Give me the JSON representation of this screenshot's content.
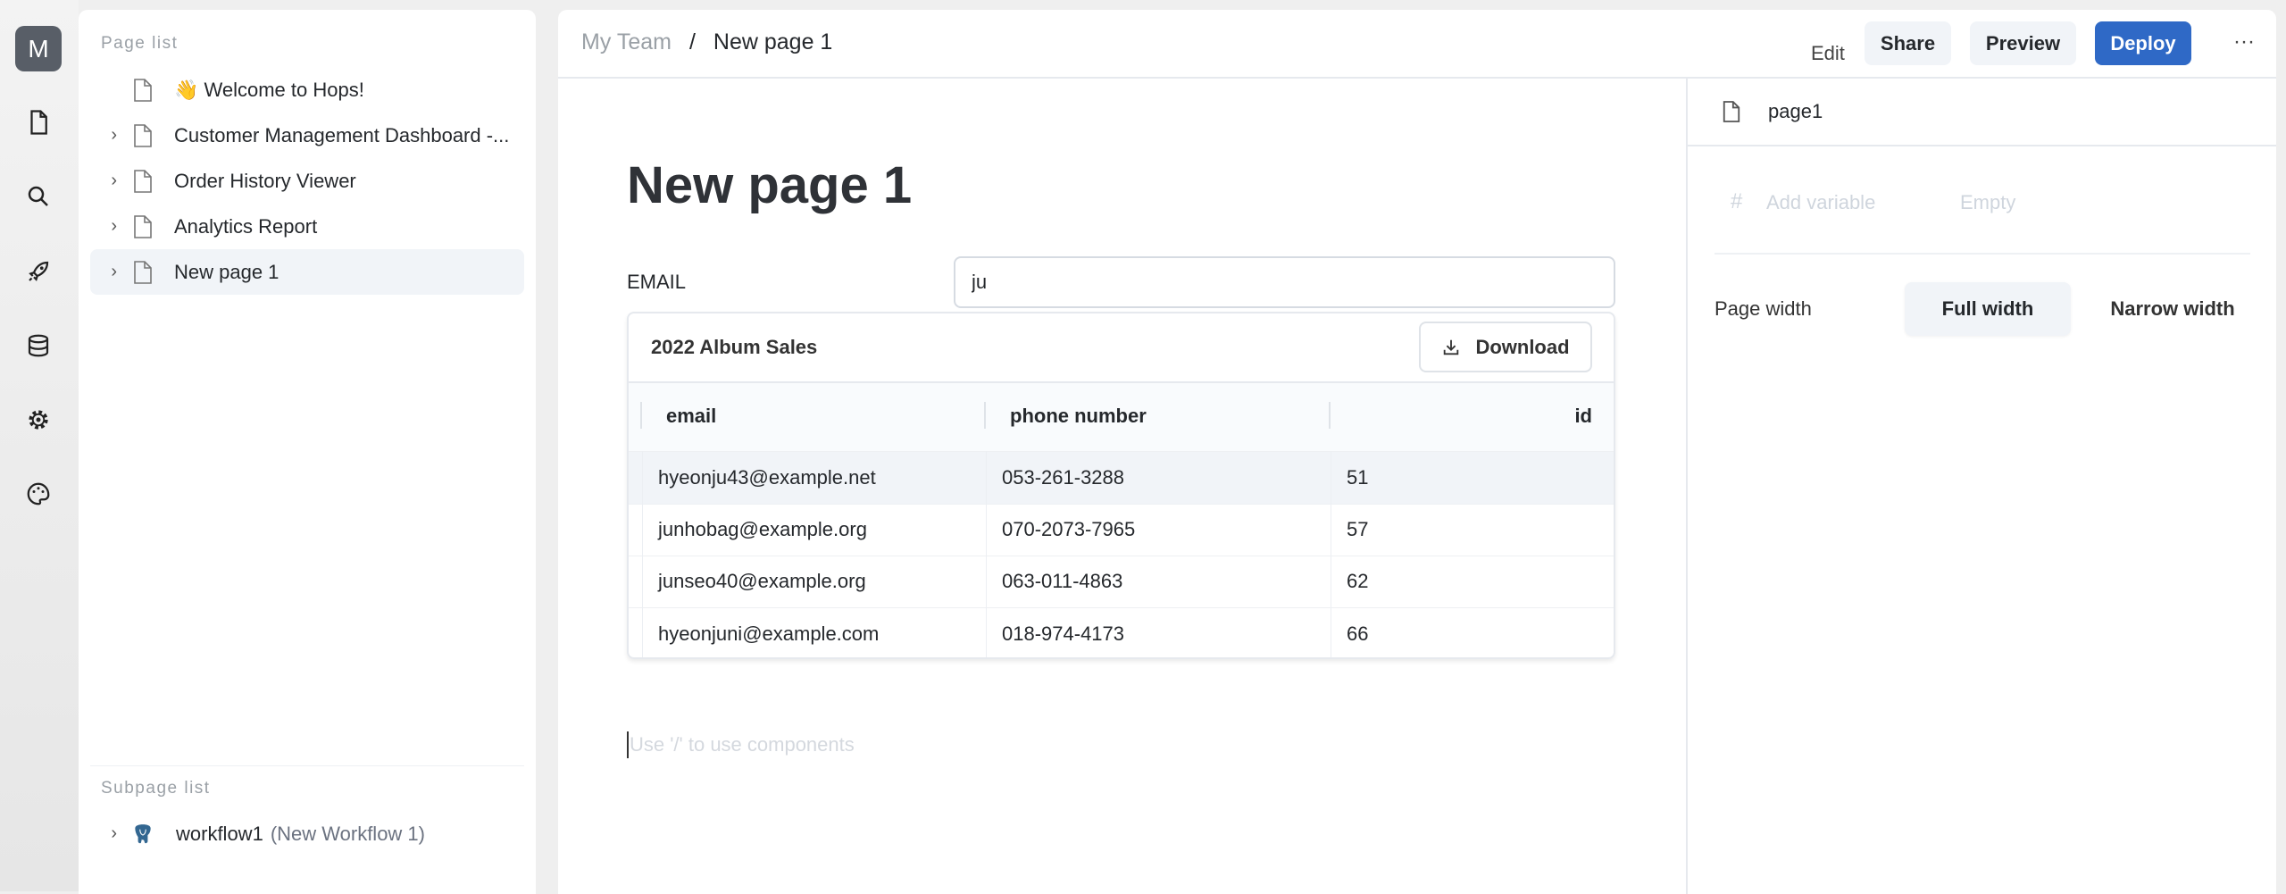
{
  "rail": {
    "avatar": "M",
    "icons": [
      "file-icon",
      "search-icon",
      "rocket-icon",
      "database-icon",
      "gear-icon",
      "palette-icon"
    ]
  },
  "sidebar": {
    "page_list_label": "Page list",
    "pages": [
      {
        "label": "👋 Welcome to Hops!",
        "expandable": false
      },
      {
        "label": "Customer Management Dashboard -...",
        "expandable": true
      },
      {
        "label": "Order History Viewer",
        "expandable": true
      },
      {
        "label": "Analytics Report",
        "expandable": true
      },
      {
        "label": "New page 1",
        "expandable": true,
        "selected": true
      }
    ],
    "subpage_list_label": "Subpage list",
    "subpages": [
      {
        "label": "workflow1",
        "sublabel": "(New Workflow 1)"
      }
    ]
  },
  "header": {
    "breadcrumb": [
      "My Team",
      "New page 1"
    ],
    "separator": "/",
    "edit": "Edit",
    "share": "Share",
    "preview": "Preview",
    "deploy": "Deploy",
    "more": "···"
  },
  "page": {
    "title": "New page 1",
    "email_label": "EMAIL",
    "email_value": "ju",
    "table": {
      "title": "2022 Album Sales",
      "download": "Download",
      "columns": [
        "email",
        "phone number",
        "id"
      ],
      "rows": [
        [
          "hyeonju43@example.net",
          "053-261-3288",
          "51"
        ],
        [
          "junhobag@example.org",
          "070-2073-7965",
          "57"
        ],
        [
          "junseo40@example.org",
          "063-011-4863",
          "62"
        ],
        [
          "hyeonjuni@example.com",
          "018-974-4173",
          "66"
        ]
      ]
    },
    "placeholder": "Use '/' to use components"
  },
  "right_panel": {
    "page_name": "page1",
    "add_variable": "Add variable",
    "empty": "Empty",
    "page_width_label": "Page width",
    "full_width": "Full width",
    "narrow_width": "Narrow width",
    "selected_width": "Full width"
  },
  "colors": {
    "accent": "#2f69c6",
    "selected_bg": "#f1f4f8"
  }
}
